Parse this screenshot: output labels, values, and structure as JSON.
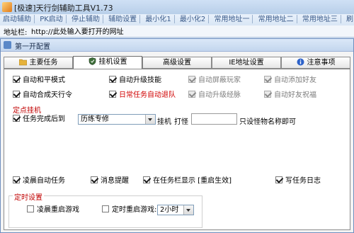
{
  "window": {
    "title": "[极速]天行剑辅助工具V1.73"
  },
  "menu": [
    "启动辅助",
    "PK启动",
    "停止辅助",
    "辅助设置",
    "最小化1",
    "最小化2",
    "常用地址一",
    "常用地址二",
    "常用地址三",
    "刷"
  ],
  "address_bar": {
    "label": "地址栏:",
    "value": "http://此处输入要打开的网址"
  },
  "dialog": {
    "title": "第一开配置",
    "tabs": [
      {
        "label": "主要任务",
        "icon": "folder-icon"
      },
      {
        "label": "挂机设置",
        "icon": "shield-icon",
        "active": true
      },
      {
        "label": "高级设置"
      },
      {
        "label": "IE地址设置"
      },
      {
        "label": "注意事项",
        "icon": "info-icon"
      }
    ],
    "options_row1": [
      {
        "label": "自动和平模式",
        "checked": true
      },
      {
        "label": "自动升级技能",
        "checked": true
      },
      {
        "label": "自动屏蔽玩家",
        "checked": true,
        "disabled": true
      },
      {
        "label": "自动添加好友",
        "checked": true,
        "disabled": true
      }
    ],
    "options_row2": [
      {
        "label": "自动合成天行令",
        "checked": true
      },
      {
        "label": "日常任务自动退队",
        "checked": true,
        "color": "#d00000"
      },
      {
        "label": "自动升级经脉",
        "checked": true,
        "disabled": true
      },
      {
        "label": "自动好友祝福",
        "checked": true,
        "disabled": true
      }
    ],
    "fixed_point": {
      "title": "定点挂机",
      "after_task_label": "任务完成后到",
      "after_task_checked": true,
      "location_value": "历练专修",
      "hang_label": "挂机",
      "fight_label": "打怪",
      "monster_input_value": "",
      "hint": "只设怪物名称即可"
    },
    "options_row3": [
      {
        "label": "凌晨自动任务",
        "checked": true
      },
      {
        "label": "消息提醒",
        "checked": true
      },
      {
        "label": "在任务栏显示 [重启生效]",
        "checked": true
      },
      {
        "label": "写任务日志",
        "checked": true
      }
    ],
    "timer": {
      "title": "定时设置",
      "dawn_restart_label": "凌晨重启游戏",
      "dawn_restart_checked": false,
      "timed_restart_label": "定时重启游戏:",
      "timed_restart_checked": false,
      "interval_value": "2小时"
    }
  }
}
